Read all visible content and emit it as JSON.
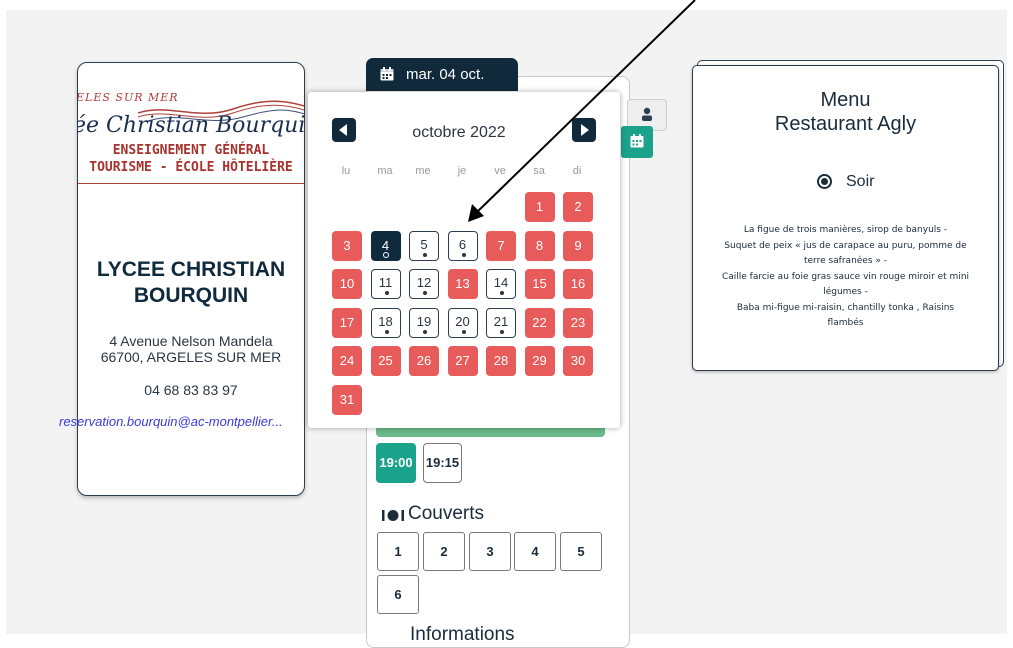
{
  "school": {
    "logo_top": "ARGELES SUR MER",
    "logo_script": "Lycée Christian Bourquin",
    "logo_line1": "ENSEIGNEMENT GÉNÉRAL",
    "logo_line2": "TOURISME - ÉCOLE HÔTELIÈRE",
    "name_line1": "LYCEE CHRISTIAN",
    "name_line2": "BOURQUIN",
    "address_line1": "4 Avenue Nelson Mandela",
    "address_line2": "66700, ARGELES SUR MER",
    "phone": "04 68 83 83 97",
    "email": "reservation.bourquin@ac-montpellier..."
  },
  "booking": {
    "date_tab": "mar. 04 oct.",
    "times": [
      "19:00",
      "19:15"
    ],
    "selected_time": "19:00",
    "couverts_label": "Couverts",
    "couverts": [
      "1",
      "2",
      "3",
      "4",
      "5",
      "6"
    ],
    "informations_label": "Informations"
  },
  "datepicker": {
    "month": "octobre 2022",
    "weekdays": [
      "lu",
      "ma",
      "me",
      "je",
      "ve",
      "sa",
      "di"
    ],
    "days": [
      {
        "n": "1",
        "state": "closed"
      },
      {
        "n": "2",
        "state": "closed"
      },
      {
        "n": "3",
        "state": "closed"
      },
      {
        "n": "4",
        "state": "today"
      },
      {
        "n": "5",
        "state": "open"
      },
      {
        "n": "6",
        "state": "open"
      },
      {
        "n": "7",
        "state": "closed"
      },
      {
        "n": "8",
        "state": "closed"
      },
      {
        "n": "9",
        "state": "closed"
      },
      {
        "n": "10",
        "state": "closed"
      },
      {
        "n": "11",
        "state": "open"
      },
      {
        "n": "12",
        "state": "open"
      },
      {
        "n": "13",
        "state": "closed"
      },
      {
        "n": "14",
        "state": "open"
      },
      {
        "n": "15",
        "state": "closed"
      },
      {
        "n": "16",
        "state": "closed"
      },
      {
        "n": "17",
        "state": "closed"
      },
      {
        "n": "18",
        "state": "open"
      },
      {
        "n": "19",
        "state": "open"
      },
      {
        "n": "20",
        "state": "open"
      },
      {
        "n": "21",
        "state": "open"
      },
      {
        "n": "22",
        "state": "closed"
      },
      {
        "n": "23",
        "state": "closed"
      },
      {
        "n": "24",
        "state": "closed"
      },
      {
        "n": "25",
        "state": "closed"
      },
      {
        "n": "26",
        "state": "closed"
      },
      {
        "n": "27",
        "state": "closed"
      },
      {
        "n": "28",
        "state": "closed"
      },
      {
        "n": "29",
        "state": "closed"
      },
      {
        "n": "30",
        "state": "closed"
      },
      {
        "n": "31",
        "state": "closed"
      }
    ]
  },
  "menu": {
    "title_line1": "Menu",
    "title_line2": "Restaurant Agly",
    "service": "Soir",
    "lines": [
      "La figue de trois manières, sirop de banyuls -",
      "Suquet de peix « jus de carapace au puru, pomme de",
      "terre safranées » -",
      "Caille farcie au foie gras sauce vin rouge miroir et mini",
      "légumes -",
      "Baba mi-figue mi-raisin, chantilly tonka , Raisins",
      "flambés"
    ]
  },
  "colors": {
    "navy": "#102a3c",
    "closed_red": "#e85b5b",
    "teal": "#1aa28a"
  }
}
